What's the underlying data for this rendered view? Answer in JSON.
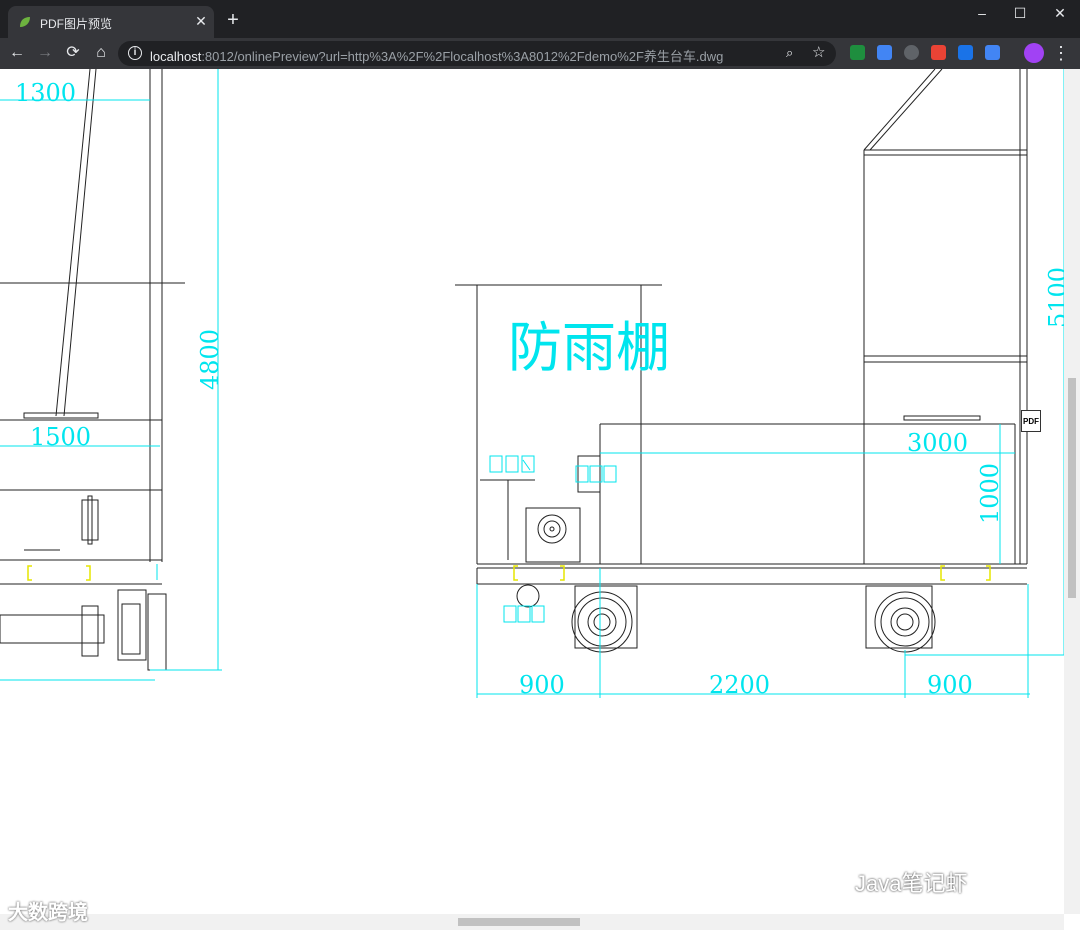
{
  "browser": {
    "tab_title": "PDF图片预览",
    "tab_close": "✕",
    "new_tab": "+",
    "window_buttons": {
      "minimize": "–",
      "maximize": "☐",
      "close": "✕"
    },
    "url_host": "localhost",
    "url_rest": ":8012/onlinePreview?url=http%3A%2F%2Flocalhost%3A8012%2Fdemo%2F养生台车.dwg",
    "nav": {
      "back": "←",
      "forward": "→",
      "reload": "⟳",
      "home": "⌂"
    },
    "icons": {
      "info": "i",
      "zoom": "⌕",
      "star": "☆",
      "menu": "⋮"
    },
    "extension_colors": [
      "#1e8e3e",
      "#4285f4",
      "#5f6368",
      "#ea4335",
      "#1a73e8",
      "#4285f4"
    ]
  },
  "drawing": {
    "labels": {
      "rain_shelter": "防雨棚",
      "dim_1300": "1300",
      "dim_1500": "1500",
      "dim_4800": "4800",
      "dim_5100": "5100",
      "dim_3000": "3000",
      "dim_1000": "1000",
      "dim_900_left": "900",
      "dim_2200": "2200",
      "dim_900_right": "900",
      "pdf_badge": "PDF"
    },
    "colors": {
      "line": "#000000",
      "dimension": "#00e5ee",
      "accent": "#e6e600"
    }
  },
  "watermarks": {
    "left": "大数跨境",
    "right": "Java笔记虾"
  }
}
